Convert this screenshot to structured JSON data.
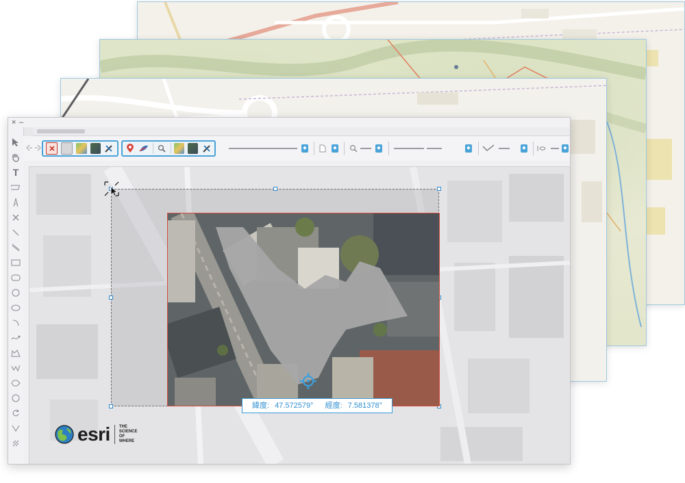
{
  "coordinates": {
    "lat_label": "緯度:",
    "lat_value": "47.572579°",
    "lon_label": "經度:",
    "lon_value": "7.581378°"
  },
  "branding": {
    "wordmark": "esri",
    "tagline_1": "THE",
    "tagline_2": "SCIENCE",
    "tagline_3": "OF",
    "tagline_4": "WHERE"
  },
  "titlebar": {
    "close_glyph": "×",
    "minimize_glyph": "–"
  },
  "colors": {
    "accent": "#4aa3d8",
    "selection_red": "#d24b3c",
    "coord_text": "#2f8fd0"
  },
  "icons": {
    "tools": [
      "pointer-icon",
      "pan-hand-icon",
      "text-icon",
      "eraser-icon",
      "pen-icon",
      "x-icon",
      "line-icon",
      "diagonal-line-icon",
      "rectangle-icon",
      "rounded-rectangle-icon",
      "circle-icon",
      "ellipse-icon",
      "arc-icon",
      "curve-icon",
      "polygon-icon",
      "freehand-icon",
      "spiral-icon",
      "rotate-icon",
      "measure-icon",
      "grid-icon"
    ]
  }
}
